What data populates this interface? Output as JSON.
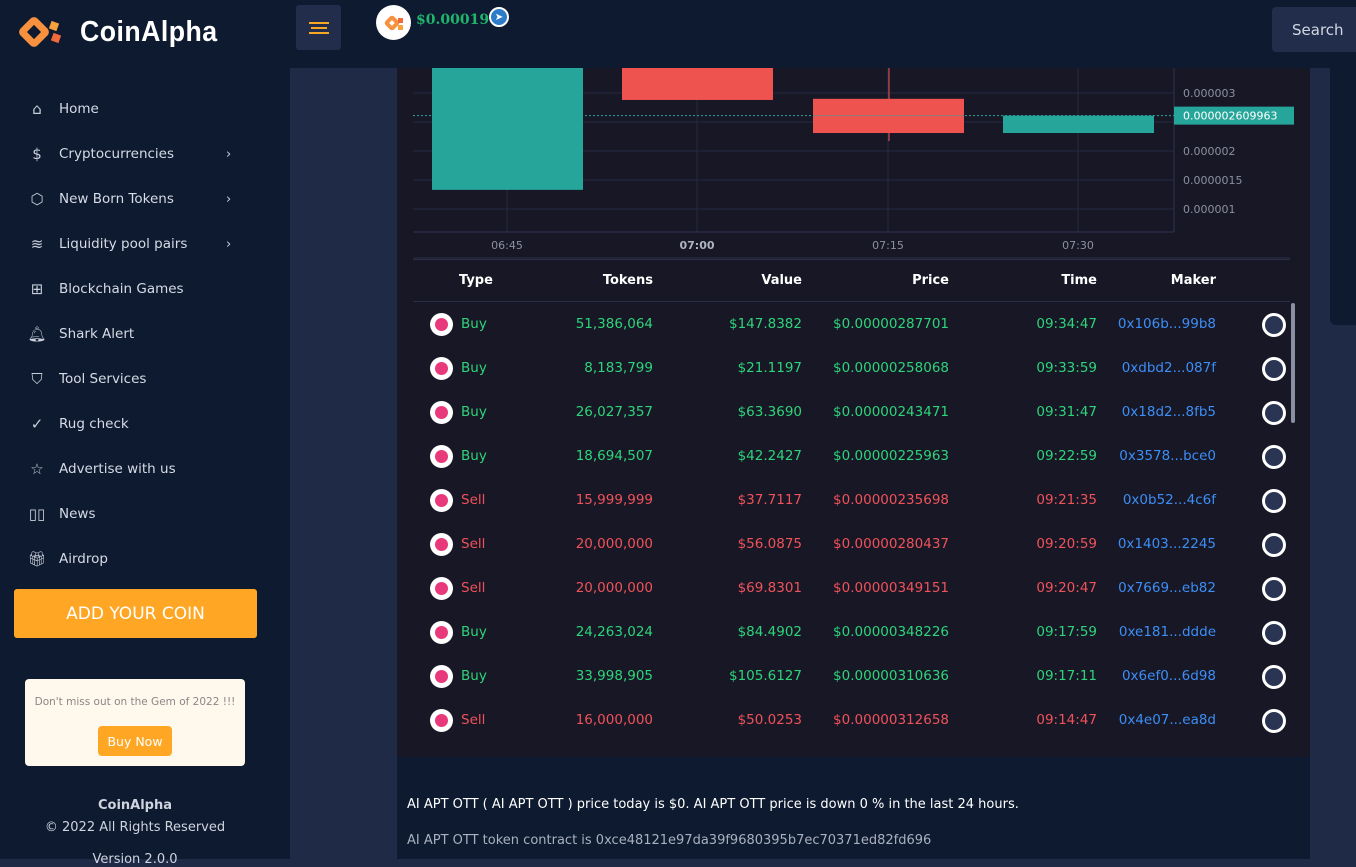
{
  "header": {
    "brand": "CoinAlpha",
    "coin_price": "$0.00019",
    "search_label": "Search"
  },
  "sidebar": {
    "items": [
      {
        "label": "Home",
        "icon": "home-icon",
        "chevron": false
      },
      {
        "label": "Cryptocurrencies",
        "icon": "dollar-icon",
        "chevron": true
      },
      {
        "label": "New Born Tokens",
        "icon": "cube-icon",
        "chevron": true
      },
      {
        "label": "Liquidity pool pairs",
        "icon": "layers-icon",
        "chevron": true
      },
      {
        "label": "Blockchain Games",
        "icon": "grid-icon",
        "chevron": false
      },
      {
        "label": "Shark Alert",
        "icon": "bell-icon",
        "chevron": false
      },
      {
        "label": "Tool Services",
        "icon": "shield-icon",
        "chevron": false
      },
      {
        "label": "Rug check",
        "icon": "check-circle-icon",
        "chevron": false
      },
      {
        "label": "Advertise with us",
        "icon": "star-icon",
        "chevron": false
      },
      {
        "label": "News",
        "icon": "book-icon",
        "chevron": false
      },
      {
        "label": "Airdrop",
        "icon": "gift-icon",
        "chevron": false
      }
    ],
    "add_coin": "ADD YOUR COIN",
    "promo_text": "Don't miss out on the Gem of 2022 !!!",
    "buy_now": "Buy Now",
    "footer_brand": "CoinAlpha",
    "footer_copy": "© 2022 All Rights Reserved",
    "footer_version": "Version 2.0.0"
  },
  "chart_data": {
    "type": "candlestick",
    "x_ticks": [
      "06:45",
      "07:00",
      "07:15",
      "07:30"
    ],
    "y_ticks": [
      "0.000003",
      "0.000002",
      "0.0000015",
      "0.000001"
    ],
    "y_tick_values": [
      3e-06,
      2e-06,
      1.5e-06,
      1e-06
    ],
    "ylim": [
      5.5e-07,
      3.43e-06
    ],
    "current_price_label": "0.000002609963",
    "current_price": 2.609963e-06,
    "candles": [
      {
        "time": "06:45",
        "open": 1.33e-06,
        "close": 3.5e-06,
        "high": 3.5e-06,
        "low": 1.33e-06
      },
      {
        "time": "07:00",
        "open": 3.6e-06,
        "close": 2.88e-06,
        "high": 3.6e-06,
        "low": 2.88e-06
      },
      {
        "time": "07:15",
        "open": 2.9e-06,
        "close": 2.31e-06,
        "high": 3.6e-06,
        "low": 2.17e-06
      },
      {
        "time": "07:30",
        "open": 2.31e-06,
        "close": 2.61e-06,
        "high": 2.61e-06,
        "low": 2.31e-06
      }
    ]
  },
  "colors": {
    "up": "#26a69a",
    "down": "#ef5350",
    "buy": "#2ed47a",
    "sell": "#f0525a",
    "maker": "#3d8ef5"
  },
  "table": {
    "headers": [
      "Type",
      "Tokens",
      "Value",
      "Price",
      "Time",
      "Maker"
    ],
    "rows": [
      {
        "type": "Buy",
        "tokens": "51,386,064",
        "value": "$147.8382",
        "price": "$0.00000287701",
        "time": "09:34:47",
        "maker": "0x106b...99b8"
      },
      {
        "type": "Buy",
        "tokens": "8,183,799",
        "value": "$21.1197",
        "price": "$0.00000258068",
        "time": "09:33:59",
        "maker": "0xdbd2...087f"
      },
      {
        "type": "Buy",
        "tokens": "26,027,357",
        "value": "$63.3690",
        "price": "$0.00000243471",
        "time": "09:31:47",
        "maker": "0x18d2...8fb5"
      },
      {
        "type": "Buy",
        "tokens": "18,694,507",
        "value": "$42.2427",
        "price": "$0.00000225963",
        "time": "09:22:59",
        "maker": "0x3578...bce0"
      },
      {
        "type": "Sell",
        "tokens": "15,999,999",
        "value": "$37.7117",
        "price": "$0.00000235698",
        "time": "09:21:35",
        "maker": "0x0b52...4c6f"
      },
      {
        "type": "Sell",
        "tokens": "20,000,000",
        "value": "$56.0875",
        "price": "$0.00000280437",
        "time": "09:20:59",
        "maker": "0x1403...2245"
      },
      {
        "type": "Sell",
        "tokens": "20,000,000",
        "value": "$69.8301",
        "price": "$0.00000349151",
        "time": "09:20:47",
        "maker": "0x7669...eb82"
      },
      {
        "type": "Buy",
        "tokens": "24,263,024",
        "value": "$84.4902",
        "price": "$0.00000348226",
        "time": "09:17:59",
        "maker": "0xe181...ddde"
      },
      {
        "type": "Buy",
        "tokens": "33,998,905",
        "value": "$105.6127",
        "price": "$0.00000310636",
        "time": "09:17:11",
        "maker": "0x6ef0...6d98"
      },
      {
        "type": "Sell",
        "tokens": "16,000,000",
        "value": "$50.0253",
        "price": "$0.00000312658",
        "time": "09:14:47",
        "maker": "0x4e07...ea8d"
      }
    ]
  },
  "info": {
    "summary": "AI APT OTT ( AI APT OTT ) price today is $0. AI APT OTT price is down 0 % in the last 24 hours.",
    "contract": "AI APT OTT token contract is 0xce48121e97da39f9680395b7ec70371ed82fd696"
  }
}
